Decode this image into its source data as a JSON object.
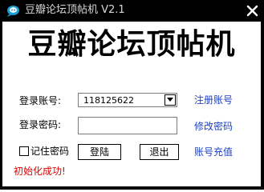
{
  "window": {
    "title": "豆瓣论坛顶帖机 V2.1",
    "close_glyph": "✕"
  },
  "banner": {
    "text": "豆瓣论坛顶帖机"
  },
  "login": {
    "account_label": "登录账号:",
    "account_value": "118125622",
    "password_label": "登录密码:",
    "password_value": "",
    "remember_label": "记住密码",
    "remember_checked": false,
    "login_button": "登陆",
    "exit_button": "退出"
  },
  "links": {
    "register": "注册账号",
    "change_password": "修改密码",
    "recharge": "账号充值"
  },
  "status": {
    "text": "初始化成功!"
  },
  "colors": {
    "link": "#1f3fbf",
    "status": "#e00000",
    "titlebar": "#000000",
    "icon": "#1aa0d8"
  },
  "icons": {
    "app": "app-logo-icon",
    "close": "close-icon",
    "dropdown": "dropdown-arrow-icon"
  }
}
